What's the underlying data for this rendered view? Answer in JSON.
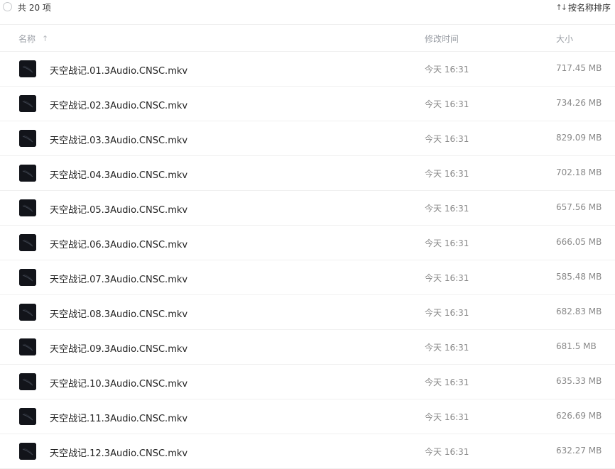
{
  "toolbar": {
    "count_label": "共 20 项",
    "sort_label": "按名称排序",
    "sort_icon_glyph": "↑↓"
  },
  "columns": {
    "name": "名称",
    "modified": "修改时间",
    "size": "大小"
  },
  "files": [
    {
      "name": "天空战记.01.3Audio.CNSC.mkv",
      "modified": "今天 16:31",
      "size": "717.45 MB"
    },
    {
      "name": "天空战记.02.3Audio.CNSC.mkv",
      "modified": "今天 16:31",
      "size": "734.26 MB"
    },
    {
      "name": "天空战记.03.3Audio.CNSC.mkv",
      "modified": "今天 16:31",
      "size": "829.09 MB"
    },
    {
      "name": "天空战记.04.3Audio.CNSC.mkv",
      "modified": "今天 16:31",
      "size": "702.18 MB"
    },
    {
      "name": "天空战记.05.3Audio.CNSC.mkv",
      "modified": "今天 16:31",
      "size": "657.56 MB"
    },
    {
      "name": "天空战记.06.3Audio.CNSC.mkv",
      "modified": "今天 16:31",
      "size": "666.05 MB"
    },
    {
      "name": "天空战记.07.3Audio.CNSC.mkv",
      "modified": "今天 16:31",
      "size": "585.48 MB"
    },
    {
      "name": "天空战记.08.3Audio.CNSC.mkv",
      "modified": "今天 16:31",
      "size": "682.83 MB"
    },
    {
      "name": "天空战记.09.3Audio.CNSC.mkv",
      "modified": "今天 16:31",
      "size": "681.5 MB"
    },
    {
      "name": "天空战记.10.3Audio.CNSC.mkv",
      "modified": "今天 16:31",
      "size": "635.33 MB"
    },
    {
      "name": "天空战记.11.3Audio.CNSC.mkv",
      "modified": "今天 16:31",
      "size": "626.69 MB"
    },
    {
      "name": "天空战记.12.3Audio.CNSC.mkv",
      "modified": "今天 16:31",
      "size": "632.27 MB"
    }
  ],
  "colors": {
    "thumb_bg": "#12141a",
    "divider": "#f0f0f0",
    "header_text": "#9a9ea5"
  }
}
